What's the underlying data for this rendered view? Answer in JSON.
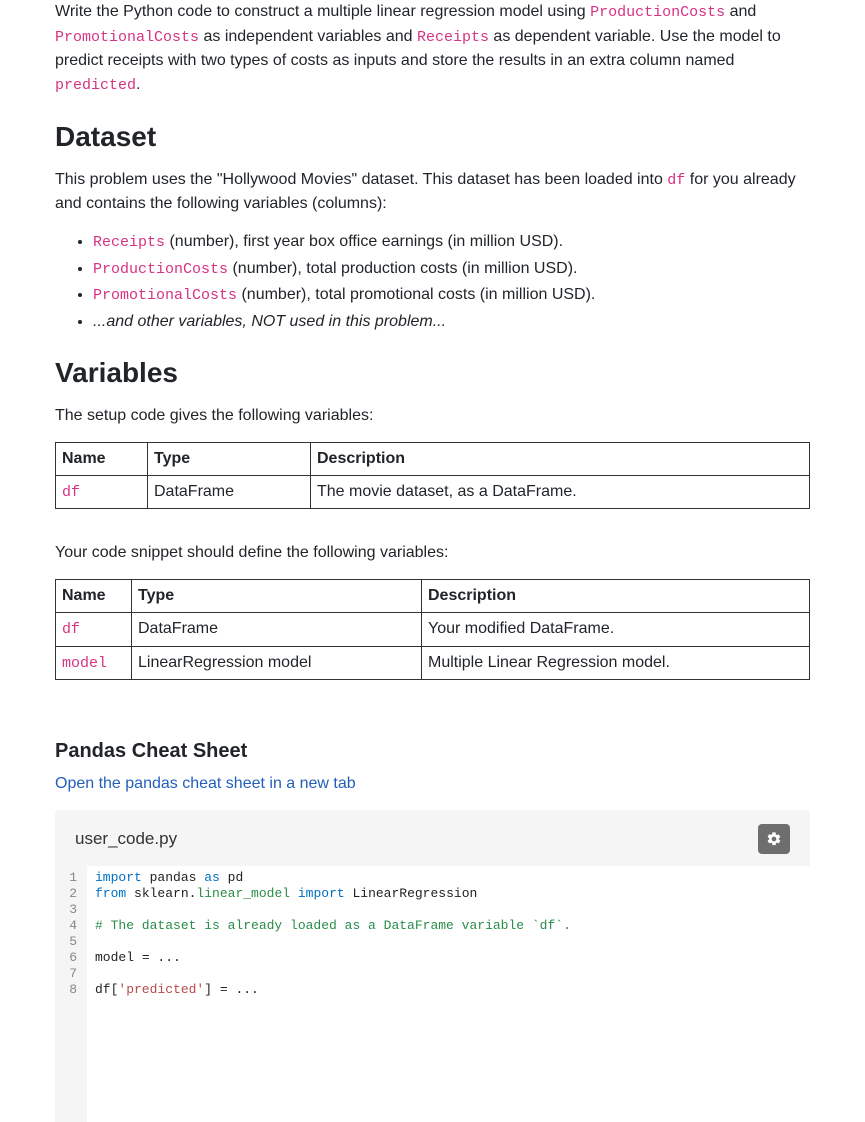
{
  "intro": {
    "p1_a": "Write the Python code to construct a multiple linear regression model using ",
    "code1": "ProductionCosts",
    "p1_b": " and ",
    "code2": "PromotionalCosts",
    "p1_c": " as independent variables and ",
    "code3": "Receipts",
    "p1_d": " as dependent variable. Use the model to predict receipts with two types of costs as inputs and store the results in an extra column named ",
    "code4": "predicted",
    "p1_e": "."
  },
  "dataset": {
    "heading": "Dataset",
    "p_a": "This problem uses the \"Hollywood Movies\" dataset. This dataset has been loaded into ",
    "p_code": "df",
    "p_b": " for you already and contains the following variables (columns):",
    "items": [
      {
        "code": "Receipts",
        "rest": " (number), first year box office earnings (in million USD)."
      },
      {
        "code": "ProductionCosts",
        "rest": " (number), total production costs (in million USD)."
      },
      {
        "code": "PromotionalCosts",
        "rest": " (number), total promotional costs (in million USD)."
      },
      {
        "note": "...and other variables, NOT used in this problem..."
      }
    ]
  },
  "variables": {
    "heading": "Variables",
    "p1": "The setup code gives the following variables:",
    "table1": {
      "headers": [
        "Name",
        "Type",
        "Description"
      ],
      "rows": [
        {
          "name_code": "df",
          "type": "DataFrame",
          "desc": "The movie dataset, as a DataFrame."
        }
      ]
    },
    "p2": "Your code snippet should define the following variables:",
    "table2": {
      "headers": [
        "Name",
        "Type",
        "Description"
      ],
      "rows": [
        {
          "name_code": "df",
          "type": "DataFrame",
          "desc": "Your modified DataFrame."
        },
        {
          "name_code": "model",
          "type": "LinearRegression model",
          "desc": "Multiple Linear Regression model."
        }
      ]
    }
  },
  "cheatsheet": {
    "heading": "Pandas Cheat Sheet",
    "link_text": "Open the pandas cheat sheet in a new tab"
  },
  "code_editor": {
    "filename": "user_code.py",
    "gear_icon": "gear-icon",
    "lines": [
      {
        "n": "1"
      },
      {
        "n": "2"
      },
      {
        "n": "3"
      },
      {
        "n": "4"
      },
      {
        "n": "5"
      },
      {
        "n": "6"
      },
      {
        "n": "7"
      },
      {
        "n": "8"
      }
    ],
    "code": {
      "l1_kw1": "import",
      "l1_mod1": " pandas ",
      "l1_kw2": "as",
      "l1_mod2": " pd",
      "l2_kw1": "from",
      "l2_mod1": " sklearn.",
      "l2_mod2": "linear_model ",
      "l2_kw2": "import",
      "l2_mod3": " LinearRegression",
      "l4_comment": "# The dataset is already loaded as a DataFrame variable `df`.",
      "l6_a": "model ",
      "l6_eq": "=",
      "l6_b": " ...",
      "l8_a": "df[",
      "l8_str": "'predicted'",
      "l8_b": "] ",
      "l8_eq": "=",
      "l8_c": " ..."
    }
  }
}
